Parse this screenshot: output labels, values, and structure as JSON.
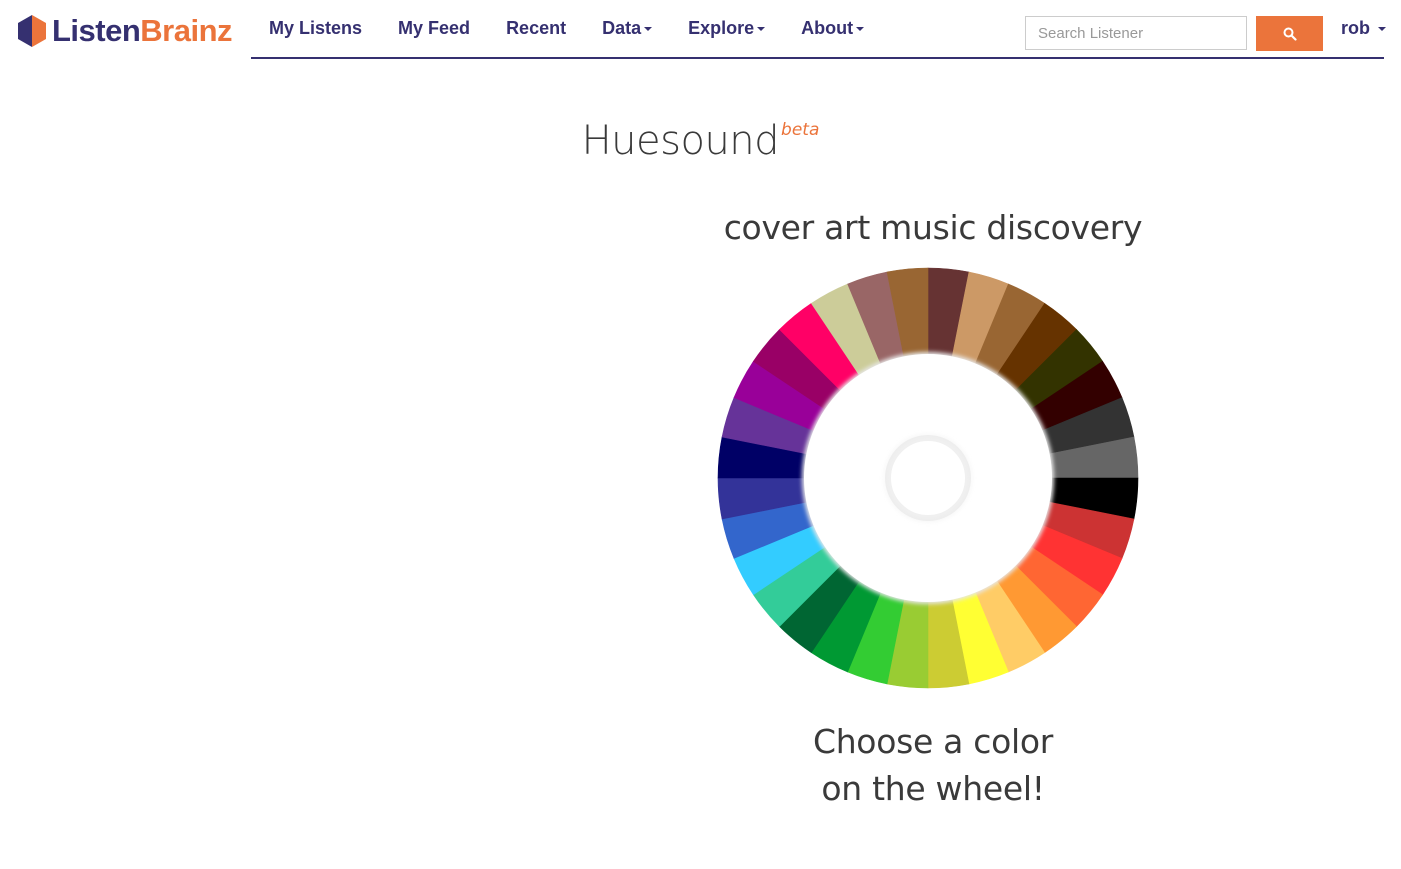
{
  "brand": {
    "listen": "Listen",
    "brainz": "Brainz",
    "colors": {
      "listen": "#353070",
      "brainz": "#eb743b"
    }
  },
  "nav": {
    "my_listens": "My Listens",
    "my_feed": "My Feed",
    "recent": "Recent",
    "data": "Data",
    "explore": "Explore",
    "about": "About"
  },
  "search": {
    "placeholder": "Search Listener",
    "button_icon": "search-icon"
  },
  "user": {
    "name": "rob"
  },
  "page": {
    "title": "Huesound",
    "beta": "beta",
    "subtitle": "cover art music discovery",
    "prompt_line1": "Choose a color",
    "prompt_line2": "on the wheel!"
  },
  "wheel": {
    "colors": [
      "#663333",
      "#cc9966",
      "#996633",
      "#663300",
      "#333300",
      "#330000",
      "#333333",
      "#666666",
      "#000000",
      "#cc3333",
      "#ff3333",
      "#ff6633",
      "#ff9933",
      "#ffcc66",
      "#ffff33",
      "#cccc33",
      "#99cc33",
      "#33cc33",
      "#009933",
      "#006633",
      "#33cc99",
      "#33ccff",
      "#3366cc",
      "#333399",
      "#000066",
      "#663399",
      "#990099",
      "#990066",
      "#ff0066",
      "#cccc99",
      "#996666",
      "#996633"
    ]
  }
}
